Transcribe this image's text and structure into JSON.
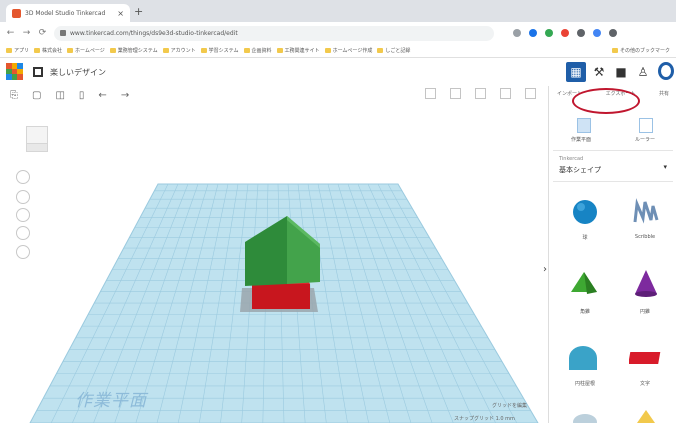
{
  "browser": {
    "tab_title": "3D Model Studio Tinkercad",
    "new_tab": "+",
    "tab_close": "×",
    "url": "www.tinkercad.com/things/ds9e3d-studio-tinkercad/edit",
    "bookmarks": [
      "アプリ",
      "株式会社",
      "ホームページ",
      "業務管理システム",
      "アカウント",
      "学習システム",
      "企画資料",
      "工務関連サイト",
      "ホームページ作成",
      "しごと記録",
      "作業スケジュール"
    ],
    "other_bookmarks": "その他のブックマーク"
  },
  "app": {
    "doc_title": "楽しいデザイン",
    "header_icons": [
      "grid-view",
      "hammer",
      "briefcase",
      "user-plus",
      "avatar"
    ]
  },
  "panel": {
    "tabs": [
      "インポート",
      "エクスポート",
      "共有"
    ],
    "sub_items": [
      "作業平面",
      "ルーラー"
    ],
    "library_small": "Tinkercad",
    "library_value": "基本シェイプ",
    "shapes": [
      {
        "name": "球",
        "color": "#1784c4"
      },
      {
        "name": "Scribble",
        "color": "#6e8fb5"
      },
      {
        "name": "角錐",
        "color": "#3ea832"
      },
      {
        "name": "円錐",
        "color": "#7d2a9e"
      },
      {
        "name": "円柱屋根",
        "color": "#3aa3c8"
      },
      {
        "name": "文字",
        "color": "#d81b2a"
      }
    ]
  },
  "canvas": {
    "workplane_label": "作業平面",
    "edit_grid": "グリッドを編集",
    "snap_grid": "スナップグリッド  1.0 mm"
  },
  "colors": {
    "workplane": "#bfe2ef",
    "grid_line": "#9bcadf",
    "roof": "#2e8b3a",
    "box": "#c8161e",
    "accent": "#1f5ea8",
    "callout": "#c0162e"
  }
}
